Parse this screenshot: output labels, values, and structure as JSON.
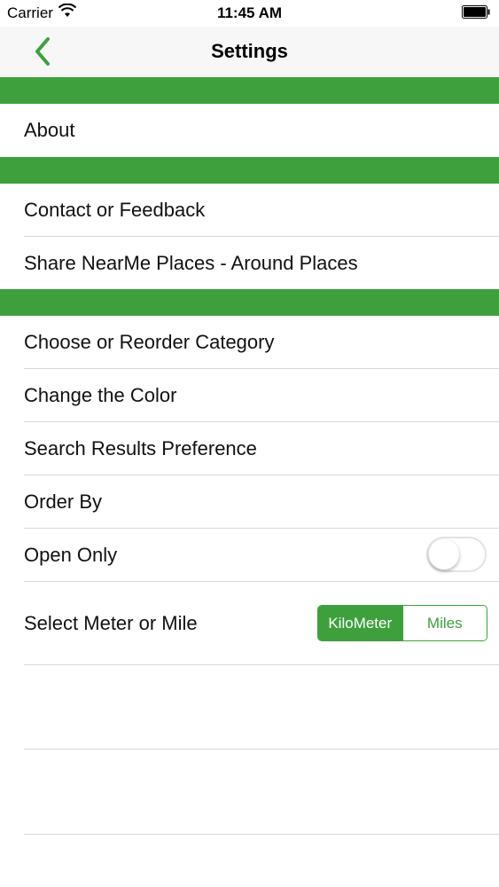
{
  "status_bar": {
    "carrier": "Carrier",
    "time": "11:45 AM",
    "wifi_icon": "wifi-icon",
    "battery_icon": "battery-icon"
  },
  "nav": {
    "title": "Settings",
    "back_icon": "chevron-left-icon"
  },
  "sections": [
    {
      "items": [
        "About"
      ]
    },
    {
      "items": [
        "Contact or Feedback",
        "Share NearMe Places - Around Places"
      ]
    },
    {
      "items": [
        "Choose or Reorder Category",
        "Change the Color",
        "Search Results Preference",
        "Order By",
        "Open Only",
        "Select Meter or Mile"
      ]
    }
  ],
  "open_only_toggle": {
    "state": "off"
  },
  "unit_selector": {
    "options": [
      "KiloMeter",
      "Miles"
    ],
    "selected": "KiloMeter"
  },
  "colors": {
    "accent": "#3da03d",
    "separator": "#d8d8d8"
  }
}
